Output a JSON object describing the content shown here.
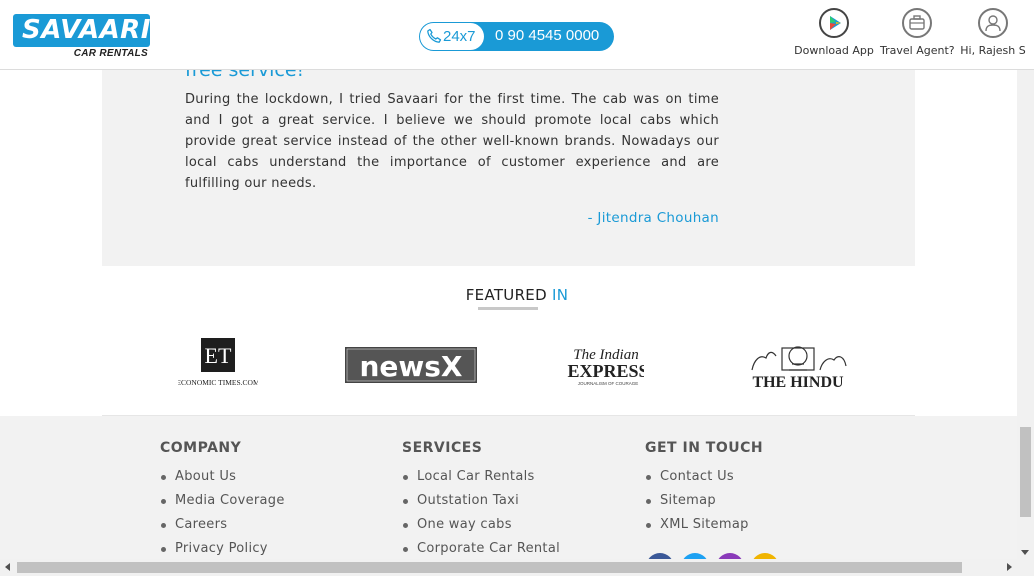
{
  "header": {
    "logo_text": "SAVAARI",
    "logo_subtext": "CAR RENTALS",
    "call_label": "24x7",
    "phone_number": "0 90 4545 0000",
    "actions": [
      {
        "label": "Download App",
        "icon": "play-store-icon"
      },
      {
        "label": "Travel Agent?",
        "icon": "briefcase-icon"
      },
      {
        "label": "Hi, Rajesh S",
        "icon": "user-icon"
      }
    ]
  },
  "testimonial": {
    "title": "free service!",
    "body": "During the lockdown, I tried Savaari for the first time. The cab was on time and I got a great service. I believe we should promote local cabs which provide great service instead of the other well-known brands. Nowadays our local cabs understand the importance of customer experience and are fulfilling our needs.",
    "author": "- Jitendra Chouhan"
  },
  "featured": {
    "title_main": "FEATURED",
    "title_accent": "IN",
    "logos": [
      {
        "name": "Economic Times",
        "mark": "ET",
        "caption": "ECONOMIC TIMES.COM"
      },
      {
        "name": "NewsX",
        "mark": "newsX"
      },
      {
        "name": "The Indian Express",
        "line1": "The Indian",
        "line2": "EXPRESS",
        "caption": "JOURNALISM OF COURAGE"
      },
      {
        "name": "The Hindu",
        "mark": "THE HINDU"
      }
    ]
  },
  "footer": {
    "company": {
      "heading": "COMPANY",
      "links": [
        "About Us",
        "Media Coverage",
        "Careers",
        "Privacy Policy"
      ]
    },
    "services": {
      "heading": "SERVICES",
      "links": [
        "Local Car Rentals",
        "Outstation Taxi",
        "One way cabs",
        "Corporate Car Rental"
      ]
    },
    "touch": {
      "heading": "GET IN TOUCH",
      "links": [
        "Contact Us",
        "Sitemap",
        "XML Sitemap"
      ]
    },
    "social": [
      {
        "icon": "facebook-icon",
        "color": "#3b5998"
      },
      {
        "icon": "twitter-icon",
        "color": "#1da1f2"
      },
      {
        "icon": "instagram-icon",
        "color": "#8a3ab9"
      },
      {
        "icon": "blog-icon",
        "color": "#f0b400"
      }
    ]
  },
  "colors": {
    "brand": "#1a9ad6",
    "panel": "#f2f2f2"
  }
}
